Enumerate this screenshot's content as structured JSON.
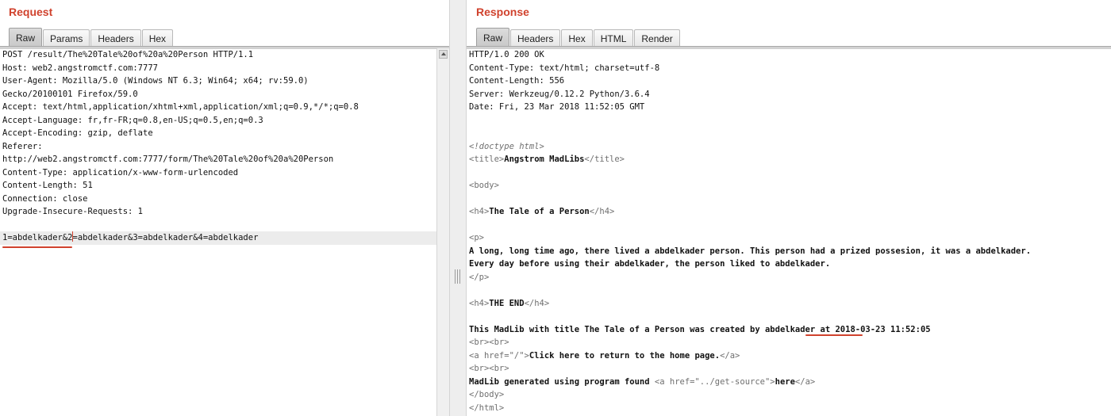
{
  "request": {
    "title": "Request",
    "tabs": [
      "Raw",
      "Params",
      "Headers",
      "Hex"
    ],
    "active_tab": "Raw",
    "lines": [
      "POST /result/The%20Tale%20of%20a%20Person HTTP/1.1",
      "Host: web2.angstromctf.com:7777",
      "User-Agent: Mozilla/5.0 (Windows NT 6.3; Win64; x64; rv:59.0)",
      "Gecko/20100101 Firefox/59.0",
      "Accept: text/html,application/xhtml+xml,application/xml;q=0.9,*/*;q=0.8",
      "Accept-Language: fr,fr-FR;q=0.8,en-US;q=0.5,en;q=0.3",
      "Accept-Encoding: gzip, deflate",
      "Referer:",
      "http://web2.angstromctf.com:7777/form/The%20Tale%20of%20a%20Person",
      "Content-Type: application/x-www-form-urlencoded",
      "Content-Length: 51",
      "Connection: close",
      "Upgrade-Insecure-Requests: 1"
    ],
    "body": "1=abdelkader&2=abdelkader&3=abdelkader&4=abdelkader"
  },
  "response": {
    "title": "Response",
    "tabs": [
      "Raw",
      "Headers",
      "Hex",
      "HTML",
      "Render"
    ],
    "active_tab": "Raw",
    "headers": [
      "HTTP/1.0 200 OK",
      "Content-Type: text/html; charset=utf-8",
      "Content-Length: 556",
      "Server: Werkzeug/0.12.2 Python/3.6.4",
      "Date: Fri, 23 Mar 2018 11:52:05 GMT"
    ],
    "doctype": "<!doctype html>",
    "title_open": "<title>",
    "title_text": "Angstrom MadLibs",
    "title_close": "</title>",
    "body_open": "<body>",
    "h4_open": "<h4>",
    "h4_close": "</h4>",
    "heading": "The Tale of a Person",
    "p_open": "<p>",
    "p_close": "</p>",
    "story_line1": "A long, long time ago, there lived a abdelkader person. This person had a prized possesion, it was a abdelkader.",
    "story_line2": "Every day before using their abdelkader, the person liked to abdelkader.",
    "the_end": "THE END",
    "created_prefix": "This MadLib with title The Tale of a Person was created by ",
    "created_name": "abdelkader",
    "created_suffix": " at 2018-03-23 11:52:05",
    "br_br": "<br><br>",
    "a_home_open": "<a href=\"/\">",
    "home_link": "Click here to return to the home page.",
    "a_close": "</a>",
    "generated_prefix": "MadLib generated using program found ",
    "a_source_open": "<a href=\"../get-source\">",
    "here_link": "here",
    "body_close": "</body>",
    "html_close": "</html>"
  },
  "colors": {
    "accent": "#d0422d"
  }
}
